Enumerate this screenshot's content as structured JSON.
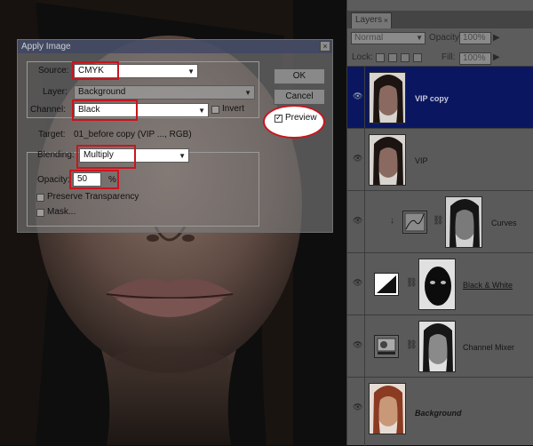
{
  "dialog": {
    "title": "Apply Image",
    "source_label": "Source:",
    "source_value": "CMYK",
    "layer_label": "Layer:",
    "layer_value": "Background",
    "channel_label": "Channel:",
    "channel_value": "Black",
    "invert_label": "Invert",
    "target_label": "Target:",
    "target_value": "01_before copy (VIP ..., RGB)",
    "blending_label": "Blending:",
    "blending_value": "Multiply",
    "opacity_label": "Opacity:",
    "opacity_value": "50",
    "opacity_unit": "%",
    "preserve_label": "Preserve Transparency",
    "mask_label": "Mask...",
    "ok_label": "OK",
    "cancel_label": "Cancel",
    "preview_label": "Preview",
    "close_glyph": "×",
    "preview_checked": true,
    "invert_checked": false,
    "preserve_checked": false,
    "mask_checked": false
  },
  "layers_panel": {
    "tab_label": "Layers",
    "tab_close": "×",
    "blend_mode": "Normal",
    "opacity_label": "Opacity:",
    "opacity_value": "100%",
    "lock_label": "Lock:",
    "fill_label": "Fill:",
    "fill_value": "100%",
    "layers": [
      {
        "name": "VIP copy",
        "selected": true
      },
      {
        "name": "VIP",
        "selected": false
      },
      {
        "name": "Curves",
        "selected": false
      },
      {
        "name": "Black & White",
        "selected": false
      },
      {
        "name": "Channel Mixer",
        "selected": false
      },
      {
        "name": "Background",
        "selected": false
      }
    ]
  },
  "colors": {
    "highlight": "#c8161e",
    "selected_layer": "#0a1760"
  }
}
